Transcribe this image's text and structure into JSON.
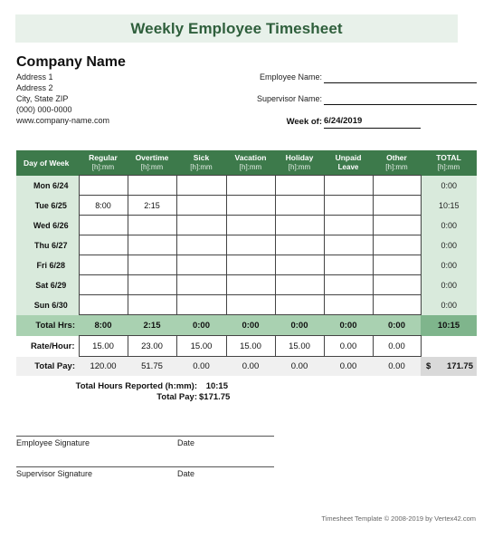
{
  "title": "Weekly Employee Timesheet",
  "company": {
    "name": "Company Name",
    "address_lines": [
      "Address 1",
      "Address 2",
      "City, State  ZIP",
      "(000) 000-0000",
      "www.company-name.com"
    ]
  },
  "fields": {
    "employee_name_label": "Employee Name:",
    "employee_name_value": "",
    "supervisor_name_label": "Supervisor Name:",
    "supervisor_name_value": "",
    "week_of_label": "Week of:",
    "week_of_value": "6/24/2019"
  },
  "table": {
    "columns": [
      {
        "label": "Day of Week",
        "sub": ""
      },
      {
        "label": "Regular",
        "sub": "[h]:mm"
      },
      {
        "label": "Overtime",
        "sub": "[h]:mm"
      },
      {
        "label": "Sick",
        "sub": "[h]:mm"
      },
      {
        "label": "Vacation",
        "sub": "[h]:mm"
      },
      {
        "label": "Holiday",
        "sub": "[h]:mm"
      },
      {
        "label": "Unpaid",
        "sub": "Leave"
      },
      {
        "label": "Other",
        "sub": "[h]:mm"
      },
      {
        "label": "TOTAL",
        "sub": "[h]:mm"
      }
    ],
    "rows": [
      {
        "day": "Mon 6/24",
        "values": [
          "",
          "",
          "",
          "",
          "",
          "",
          ""
        ],
        "total": "0:00"
      },
      {
        "day": "Tue 6/25",
        "values": [
          "8:00",
          "2:15",
          "",
          "",
          "",
          "",
          ""
        ],
        "total": "10:15"
      },
      {
        "day": "Wed 6/26",
        "values": [
          "",
          "",
          "",
          "",
          "",
          "",
          ""
        ],
        "total": "0:00"
      },
      {
        "day": "Thu 6/27",
        "values": [
          "",
          "",
          "",
          "",
          "",
          "",
          ""
        ],
        "total": "0:00"
      },
      {
        "day": "Fri 6/28",
        "values": [
          "",
          "",
          "",
          "",
          "",
          "",
          ""
        ],
        "total": "0:00"
      },
      {
        "day": "Sat 6/29",
        "values": [
          "",
          "",
          "",
          "",
          "",
          "",
          ""
        ],
        "total": "0:00"
      },
      {
        "day": "Sun 6/30",
        "values": [
          "",
          "",
          "",
          "",
          "",
          "",
          ""
        ],
        "total": "0:00"
      }
    ],
    "total_hrs": {
      "label": "Total Hrs:",
      "values": [
        "8:00",
        "2:15",
        "0:00",
        "0:00",
        "0:00",
        "0:00",
        "0:00"
      ],
      "total": "10:15"
    },
    "rate_hour": {
      "label": "Rate/Hour:",
      "values": [
        "15.00",
        "23.00",
        "15.00",
        "15.00",
        "15.00",
        "0.00",
        "0.00"
      ]
    },
    "total_pay": {
      "label": "Total Pay:",
      "values": [
        "120.00",
        "51.75",
        "0.00",
        "0.00",
        "0.00",
        "0.00",
        "0.00"
      ],
      "currency": "$",
      "total": "171.75"
    }
  },
  "summary": {
    "hours_label": "Total Hours Reported (h:mm):",
    "hours_value": "10:15",
    "pay_label": "Total Pay:",
    "pay_value": "$171.75"
  },
  "signatures": {
    "employee_label": "Employee Signature",
    "supervisor_label": "Supervisor Signature",
    "date_label": "Date"
  },
  "footer": "Timesheet Template © 2008-2019 by Vertex42.com",
  "colors": {
    "header_green": "#3d7a4b",
    "title_text": "#2f5f3c",
    "title_bg": "#e8f1ea",
    "day_bg": "#d9eadc",
    "total_hrs_bg": "#a9d1b1"
  }
}
